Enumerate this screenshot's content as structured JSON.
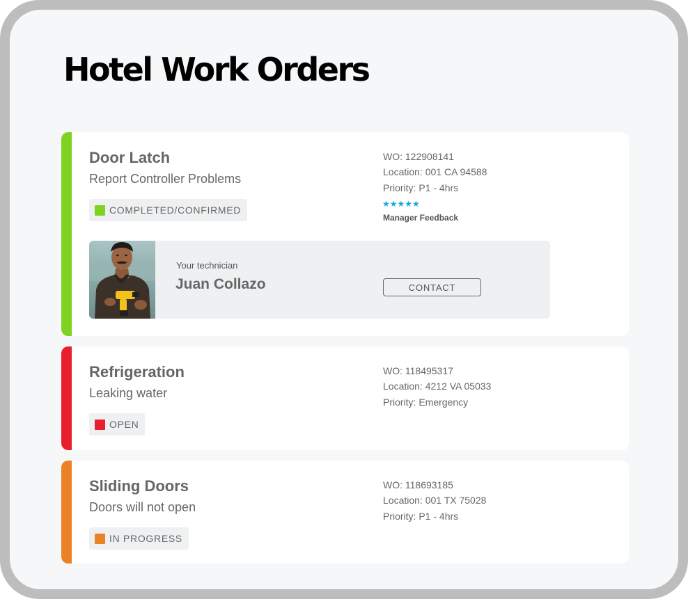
{
  "page": {
    "title": "Hotel Work Orders"
  },
  "orders": [
    {
      "title": "Door Latch",
      "subtitle": "Report Controller Problems",
      "status": {
        "label": "COMPLETED/CONFIRMED",
        "color": "#7ed321"
      },
      "accent_color": "#7ed321",
      "wo": "WO: 122908141",
      "location": "Location: 001 CA 94588",
      "priority": "Priority: P1 - 4hrs",
      "rating": {
        "stars": "★★★★★",
        "value": 5,
        "max": 5,
        "label": "Manager Feedback",
        "color": "#13a9dc"
      },
      "technician": {
        "caption": "Your technician",
        "name": "Juan Collazo",
        "contact_label": "CONTACT",
        "photo_icon": "technician-photo"
      }
    },
    {
      "title": "Refrigeration",
      "subtitle": "Leaking water",
      "status": {
        "label": "OPEN",
        "color": "#e8202e"
      },
      "accent_color": "#e8202e",
      "wo": "WO: 118495317",
      "location": "Location: 4212 VA 05033",
      "priority": "Priority: Emergency"
    },
    {
      "title": "Sliding Doors",
      "subtitle": "Doors will not open",
      "status": {
        "label": "IN PROGRESS",
        "color": "#eb8324"
      },
      "accent_color": "#eb8324",
      "wo": "WO: 118693185",
      "location": "Location: 001 TX 75028",
      "priority": "Priority: P1 - 4hrs"
    }
  ]
}
